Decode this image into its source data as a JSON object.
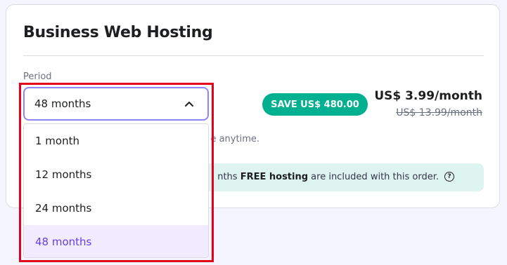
{
  "card": {
    "title": "Business Web Hosting",
    "period_label": "Period",
    "save_badge": "SAVE US$ 480.00",
    "price": "US$ 3.99/month",
    "old_price": "US$ 13.99/month",
    "renew_suffix": "e anytime.",
    "info": {
      "prefix": "nths ",
      "bold": "FREE hosting",
      "suffix": " are included with this order.",
      "help_icon": "?"
    }
  },
  "period_select": {
    "value": "48 months",
    "options": [
      "1 month",
      "12 months",
      "24 months",
      "48 months"
    ],
    "selected_index": 3
  },
  "colors": {
    "accent": "#673de6",
    "save_badge": "#00b090",
    "highlight_border": "#e3001b",
    "info_bg": "#def4f0"
  }
}
